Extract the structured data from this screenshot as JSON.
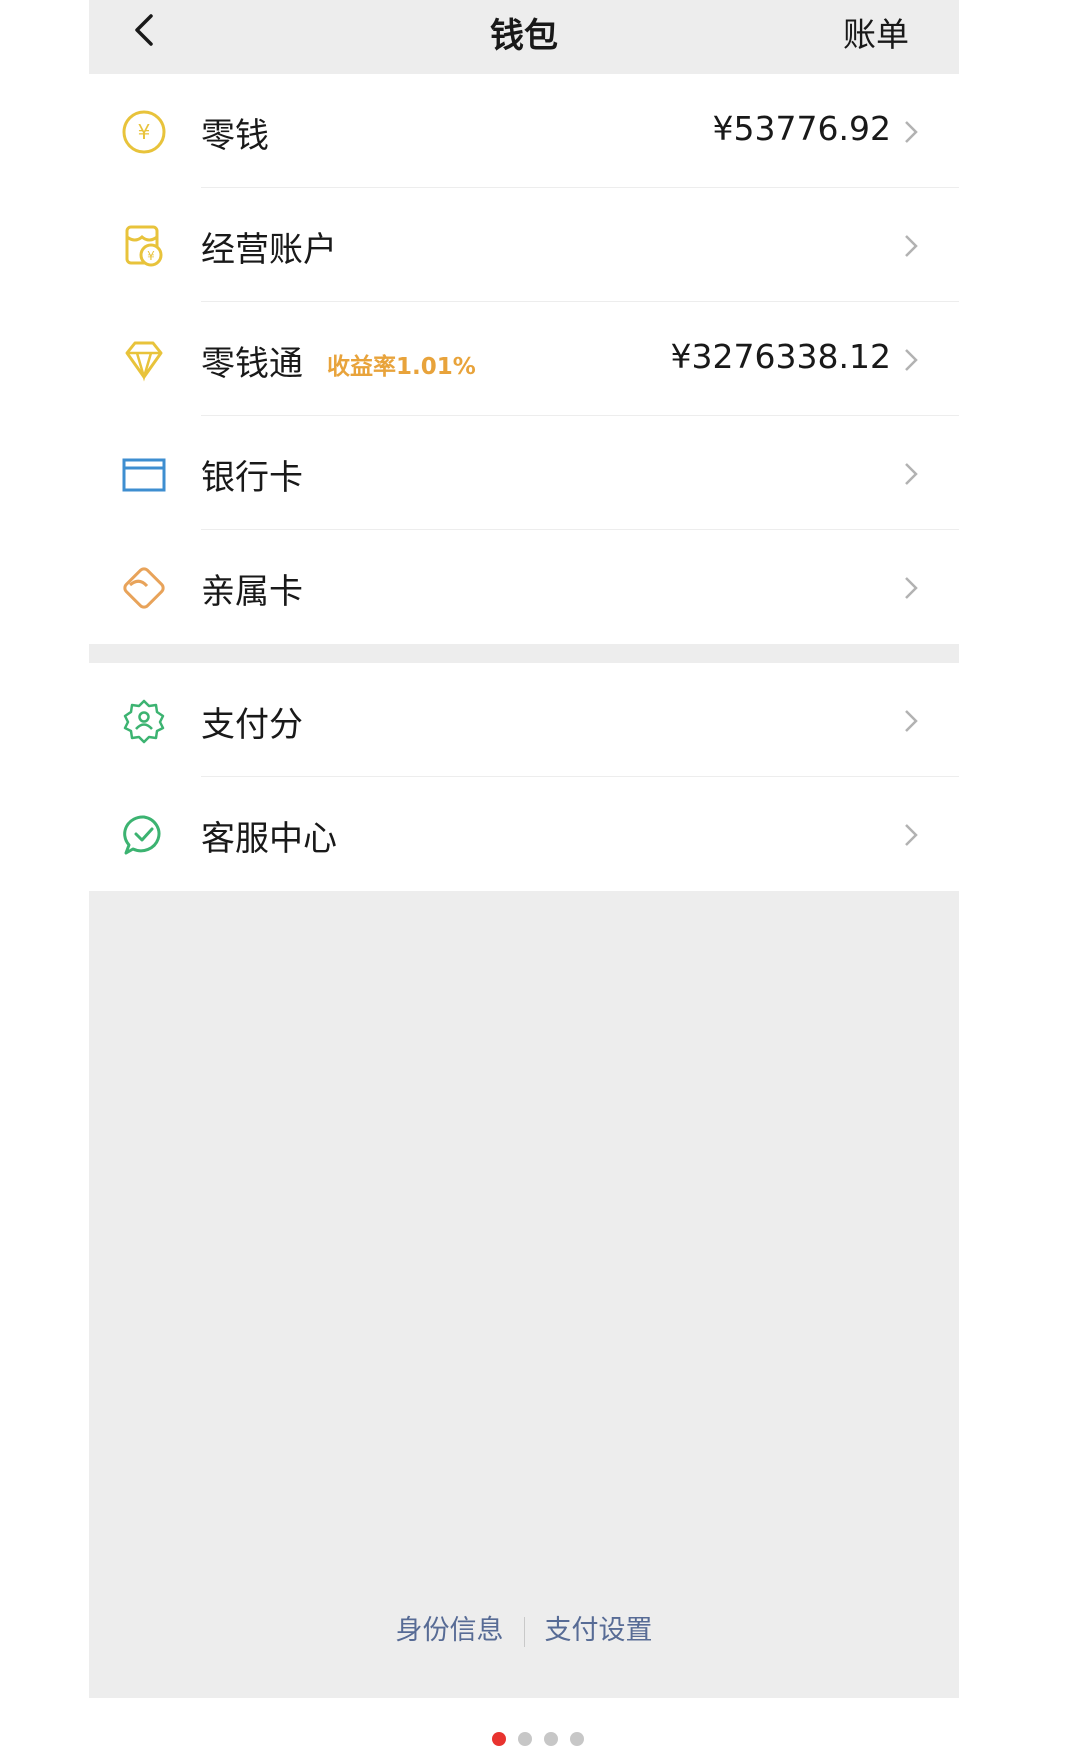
{
  "header": {
    "title": "钱包",
    "right_label": "账单"
  },
  "groups": [
    [
      {
        "label": "零钱",
        "amount": "¥53776.92",
        "icon": "coin-icon",
        "color": "#e8c33b"
      },
      {
        "label": "经营账户",
        "icon": "business-account-icon",
        "color": "#e8c33b"
      },
      {
        "label": "零钱通",
        "rate": "收益率1.01%",
        "amount": "¥3276338.12",
        "icon": "diamond-icon",
        "color": "#e8c33b"
      },
      {
        "label": "银行卡",
        "icon": "bank-card-icon",
        "color": "#3e8ed0"
      },
      {
        "label": "亲属卡",
        "icon": "family-card-icon",
        "color": "#e8a35a"
      }
    ],
    [
      {
        "label": "支付分",
        "icon": "pay-score-icon",
        "color": "#3cb371"
      },
      {
        "label": "客服中心",
        "icon": "customer-service-icon",
        "color": "#3cb371"
      }
    ]
  ],
  "footer": {
    "identity": "身份信息",
    "pay_settings": "支付设置"
  },
  "pagination": {
    "count": 4,
    "active": 0
  },
  "colors": {
    "background": "#ededed",
    "accent_rate": "#e8a33b",
    "link": "#576b95",
    "dot_active": "#e8332f"
  }
}
